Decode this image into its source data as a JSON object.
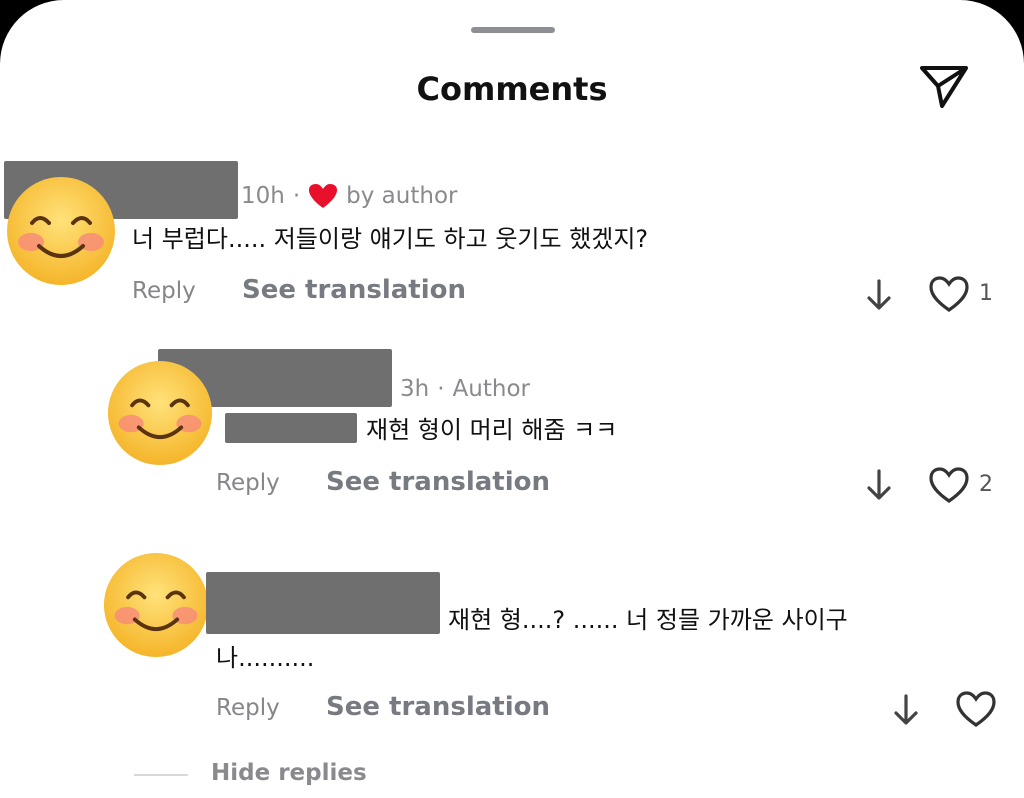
{
  "header": {
    "title": "Comments"
  },
  "comments": [
    {
      "time": "10h",
      "sep": "·",
      "badge": "by author",
      "text": "너 부럽다..... 저들이랑 얘기도 하고 웃기도 했겠지?",
      "reply_label": "Reply",
      "translate_label": "See translation",
      "likes": "1"
    },
    {
      "time": "3h",
      "sep": "·",
      "badge": "Author",
      "text": "재현 형이 머리 해줌 ㅋㅋ",
      "reply_label": "Reply",
      "translate_label": "See translation",
      "likes": "2"
    },
    {
      "text_line1": "재현 형....? ...... 너 정믈 가까운 사이구",
      "text_line2": "나..........",
      "reply_label": "Reply",
      "translate_label": "See translation"
    }
  ],
  "footer": {
    "hide_replies": "Hide replies"
  },
  "icons": {
    "send": "send-icon",
    "heart": "heart-icon",
    "down": "arrow-down-icon",
    "avatar": "smiling-face-emoji"
  },
  "colors": {
    "heart_filled": "#e8102a",
    "mention": "#3b5ec9",
    "redaction": "#6f6f6f"
  }
}
